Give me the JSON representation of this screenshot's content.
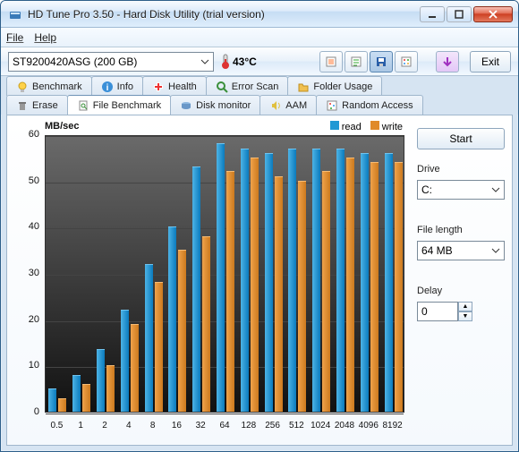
{
  "window": {
    "title": "HD Tune Pro 3.50 - Hard Disk Utility (trial version)"
  },
  "menu": {
    "file": "File",
    "help": "Help"
  },
  "toolbar": {
    "drive_selected": "ST9200420ASG (200 GB)",
    "temperature": "43°C",
    "exit_label": "Exit",
    "buttons": [
      "copy-screenshot",
      "copy-text",
      "save",
      "options",
      "down-arrow"
    ]
  },
  "tabs_row1": [
    {
      "label": "Benchmark",
      "icon": "bulb"
    },
    {
      "label": "Info",
      "icon": "info"
    },
    {
      "label": "Health",
      "icon": "health"
    },
    {
      "label": "Error Scan",
      "icon": "search"
    },
    {
      "label": "Folder Usage",
      "icon": "folder"
    }
  ],
  "tabs_row2": [
    {
      "label": "Erase",
      "icon": "trash"
    },
    {
      "label": "File Benchmark",
      "icon": "file",
      "active": true
    },
    {
      "label": "Disk monitor",
      "icon": "disk"
    },
    {
      "label": "AAM",
      "icon": "sound"
    },
    {
      "label": "Random Access",
      "icon": "random"
    }
  ],
  "side": {
    "start_label": "Start",
    "drive_label": "Drive",
    "drive_value": "C:",
    "filelen_label": "File length",
    "filelen_value": "64 MB",
    "delay_label": "Delay",
    "delay_value": "0"
  },
  "chart_data": {
    "type": "bar",
    "ylabel": "MB/sec",
    "ylim": [
      0,
      60
    ],
    "yticks": [
      0,
      10,
      20,
      30,
      40,
      50,
      60
    ],
    "categories": [
      "0.5",
      "1",
      "2",
      "4",
      "8",
      "16",
      "32",
      "64",
      "128",
      "256",
      "512",
      "1024",
      "2048",
      "4096",
      "8192"
    ],
    "series": [
      {
        "name": "read",
        "color": "#1f98d4",
        "values": [
          5,
          8,
          13.5,
          22,
          32,
          40,
          53,
          58,
          57,
          56,
          57,
          57,
          57,
          56,
          56
        ]
      },
      {
        "name": "write",
        "color": "#e08a2a",
        "values": [
          3,
          6,
          10,
          19,
          28,
          35,
          38,
          52,
          55,
          51,
          50,
          52,
          55,
          54,
          54
        ]
      }
    ]
  }
}
